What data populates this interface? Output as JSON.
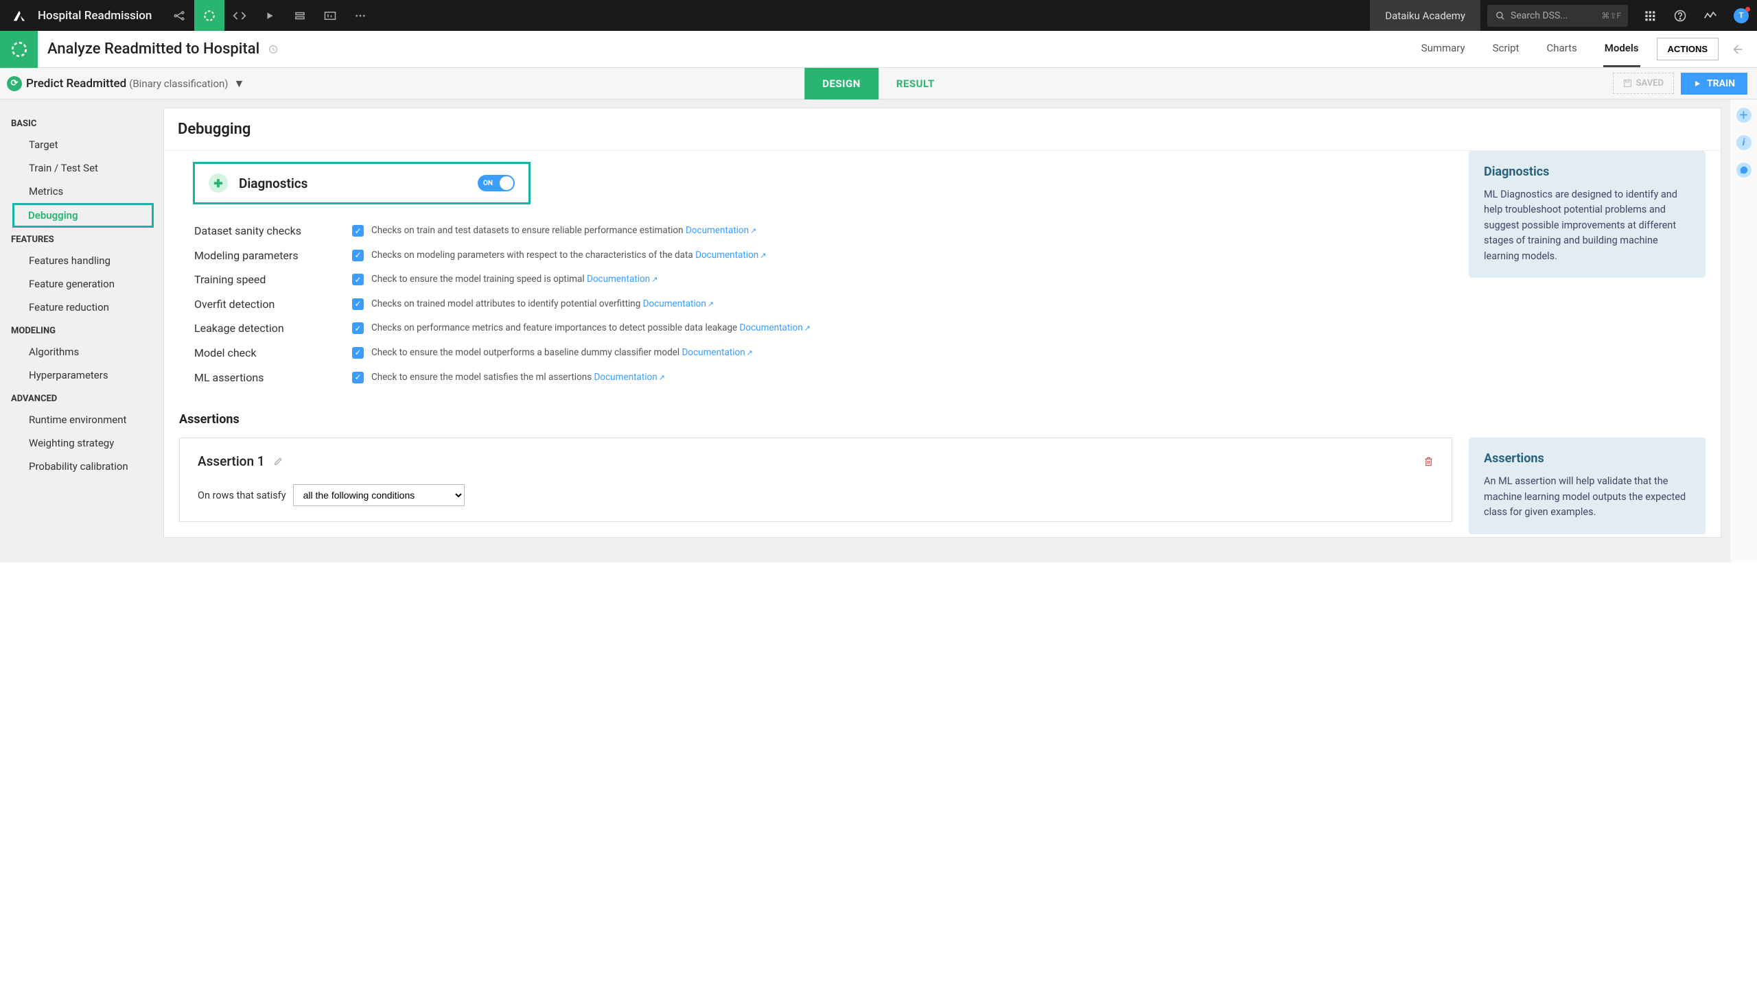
{
  "topbar": {
    "project_name": "Hospital Readmission",
    "academy_label": "Dataiku Academy",
    "search_placeholder": "Search DSS...",
    "search_hint": "⌘⇧F",
    "avatar_initial": "T"
  },
  "subheader": {
    "title": "Analyze Readmitted to Hospital",
    "tabs": [
      "Summary",
      "Script",
      "Charts",
      "Models"
    ],
    "active_tab": "Models",
    "actions_label": "ACTIONS"
  },
  "modelbar": {
    "predict_label": "Predict Readmitted",
    "predict_kind": "(Binary classification)",
    "design_label": "DESIGN",
    "result_label": "RESULT",
    "saved_label": "SAVED",
    "train_label": "TRAIN"
  },
  "sidebar": {
    "sections": [
      {
        "name": "BASIC",
        "items": [
          "Target",
          "Train / Test Set",
          "Metrics",
          "Debugging"
        ],
        "active": "Debugging"
      },
      {
        "name": "FEATURES",
        "items": [
          "Features handling",
          "Feature generation",
          "Feature reduction"
        ]
      },
      {
        "name": "MODELING",
        "items": [
          "Algorithms",
          "Hyperparameters"
        ]
      },
      {
        "name": "ADVANCED",
        "items": [
          "Runtime environment",
          "Weighting strategy",
          "Probability calibration"
        ]
      }
    ]
  },
  "main": {
    "panel_title": "Debugging",
    "diagnostics": {
      "label": "Diagnostics",
      "toggle": "ON",
      "checks": [
        {
          "label": "Dataset sanity checks",
          "desc": "Checks on train and test datasets to ensure reliable performance estimation",
          "doc": "Documentation"
        },
        {
          "label": "Modeling parameters",
          "desc": "Checks on modeling parameters with respect to the characteristics of the data",
          "doc": "Documentation"
        },
        {
          "label": "Training speed",
          "desc": "Check to ensure the model training speed is optimal",
          "doc": "Documentation"
        },
        {
          "label": "Overfit detection",
          "desc": "Checks on trained model attributes to identify potential overfitting",
          "doc": "Documentation"
        },
        {
          "label": "Leakage detection",
          "desc": "Checks on performance metrics and feature importances to detect possible data leakage",
          "doc": "Documentation"
        },
        {
          "label": "Model check",
          "desc": "Check to ensure the model outperforms a baseline dummy classifier model",
          "doc": "Documentation"
        },
        {
          "label": "ML assertions",
          "desc": "Check to ensure the model satisfies the ml assertions",
          "doc": "Documentation"
        }
      ],
      "info_title": "Diagnostics",
      "info_body": "ML Diagnostics are designed to identify and help troubleshoot potential problems and suggest possible improvements at different stages of training and building machine learning models."
    },
    "assertions": {
      "header": "Assertions",
      "card_title": "Assertion 1",
      "filter_label": "On rows that satisfy",
      "filter_value": "all the following conditions",
      "info_title": "Assertions",
      "info_body": "An ML assertion will help validate that the machine learning model outputs the expected class for given examples."
    }
  }
}
